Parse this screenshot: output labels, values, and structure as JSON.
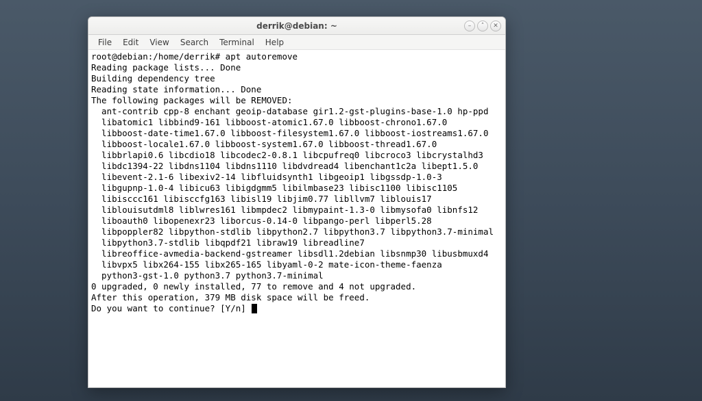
{
  "window": {
    "title": "derrik@debian: ~"
  },
  "menubar": {
    "items": [
      "File",
      "Edit",
      "View",
      "Search",
      "Terminal",
      "Help"
    ]
  },
  "terminal": {
    "lines": [
      "root@debian:/home/derrik# apt autoremove",
      "Reading package lists... Done",
      "Building dependency tree",
      "Reading state information... Done",
      "The following packages will be REMOVED:",
      "  ant-contrib cpp-8 enchant geoip-database gir1.2-gst-plugins-base-1.0 hp-ppd",
      "  libatomic1 libbind9-161 libboost-atomic1.67.0 libboost-chrono1.67.0",
      "  libboost-date-time1.67.0 libboost-filesystem1.67.0 libboost-iostreams1.67.0",
      "  libboost-locale1.67.0 libboost-system1.67.0 libboost-thread1.67.0",
      "  libbrlapi0.6 libcdio18 libcodec2-0.8.1 libcpufreq0 libcroco3 libcrystalhd3",
      "  libdc1394-22 libdns1104 libdns1110 libdvdread4 libenchant1c2a libept1.5.0",
      "  libevent-2.1-6 libexiv2-14 libfluidsynth1 libgeoip1 libgssdp-1.0-3",
      "  libgupnp-1.0-4 libicu63 libigdgmm5 libilmbase23 libisc1100 libisc1105",
      "  libisccc161 libisccfg163 libisl19 libjim0.77 libllvm7 liblouis17",
      "  liblouisutdml8 liblwres161 libmpdec2 libmypaint-1.3-0 libmysofa0 libnfs12",
      "  liboauth0 libopenexr23 liborcus-0.14-0 libpango-perl libperl5.28",
      "  libpoppler82 libpython-stdlib libpython2.7 libpython3.7 libpython3.7-minimal",
      "  libpython3.7-stdlib libqpdf21 libraw19 libreadline7",
      "  libreoffice-avmedia-backend-gstreamer libsdl1.2debian libsnmp30 libusbmuxd4",
      "  libvpx5 libx264-155 libx265-165 libyaml-0-2 mate-icon-theme-faenza",
      "  python3-gst-1.0 python3.7 python3.7-minimal",
      "0 upgraded, 0 newly installed, 77 to remove and 4 not upgraded.",
      "After this operation, 379 MB disk space will be freed.",
      "Do you want to continue? [Y/n] "
    ]
  },
  "controls": {
    "minimize": "–",
    "maximize": "˄",
    "close": "✕"
  }
}
